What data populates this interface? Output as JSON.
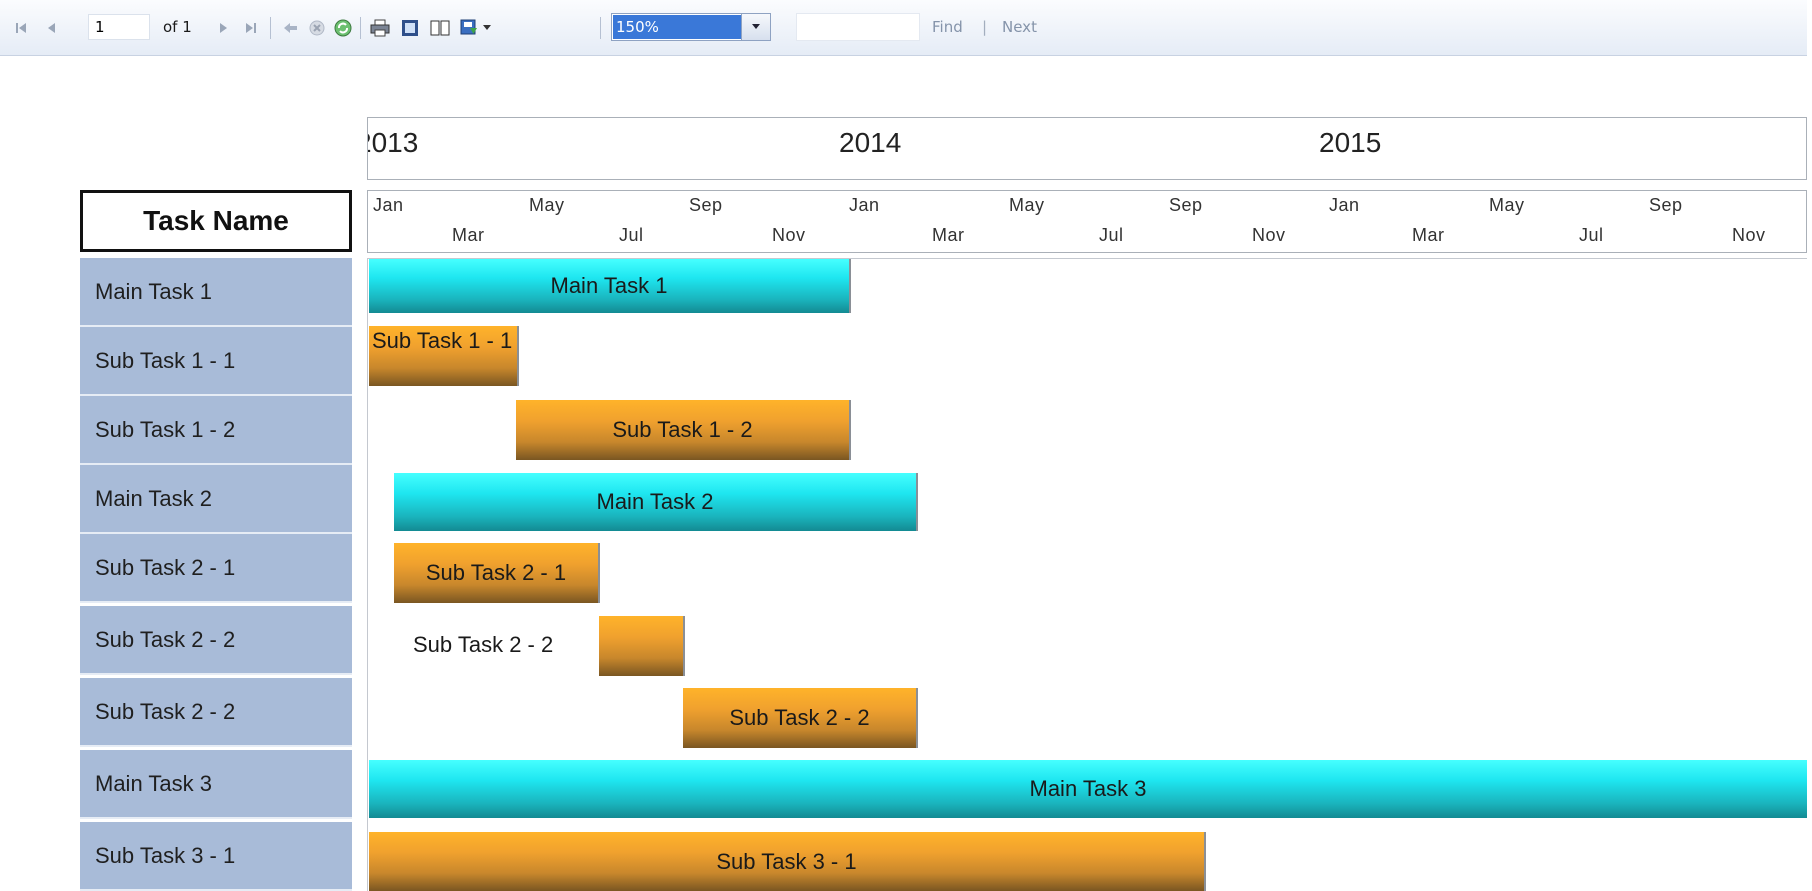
{
  "toolbar": {
    "page_value": "1",
    "of_label": "of 1",
    "zoom_value": "150%",
    "find_label": "Find",
    "separator": "|",
    "next_label": "Next",
    "icons": [
      "first-page-icon",
      "previous-page-icon",
      "next-page-icon",
      "last-page-icon",
      "back-icon",
      "stop-icon",
      "refresh-icon",
      "print-icon",
      "print-layout-icon",
      "page-setup-icon",
      "export-icon",
      "dropdown-arrow-icon"
    ]
  },
  "timeline": {
    "years": [
      "2013",
      "2014",
      "2015"
    ],
    "months_top": [
      "Jan",
      "May",
      "Sep",
      "Jan",
      "May",
      "Sep",
      "Jan",
      "May",
      "Sep"
    ],
    "months_bottom": [
      "Mar",
      "Jul",
      "Nov",
      "Mar",
      "Jul",
      "Nov",
      "Mar",
      "Jul",
      "Nov"
    ]
  },
  "header": {
    "task_name": "Task Name"
  },
  "tasks": [
    {
      "name": "Main Task 1",
      "bar_label": "Main Task 1",
      "kind": "main",
      "start": "2013-01",
      "end": "2013-12"
    },
    {
      "name": "Sub Task 1 - 1",
      "bar_label": "Sub Task 1 - 1",
      "kind": "sub",
      "start": "2013-01",
      "end": "2013-04"
    },
    {
      "name": "Sub Task 1 - 2",
      "bar_label": "Sub Task 1 - 2",
      "kind": "sub",
      "start": "2013-04",
      "end": "2013-12"
    },
    {
      "name": "Main Task 2",
      "bar_label": "Main Task 2",
      "kind": "main",
      "start": "2013-02",
      "end": "2014-02"
    },
    {
      "name": "Sub Task 2 - 1",
      "bar_label": "Sub Task 2 - 1",
      "kind": "sub",
      "start": "2013-02",
      "end": "2013-06"
    },
    {
      "name": "Sub Task 2 - 2",
      "bar_label": "Sub Task 2 - 2",
      "kind": "sub",
      "start": "2013-06",
      "end": "2013-08"
    },
    {
      "name": "Sub Task 2 - 2",
      "bar_label": "Sub Task 2 - 2",
      "kind": "sub",
      "start": "2013-08",
      "end": "2014-02"
    },
    {
      "name": "Main Task 3",
      "bar_label": "Main Task 3",
      "kind": "main",
      "start": "2013-01",
      "end": "2015-12"
    },
    {
      "name": "Sub Task 3 - 1",
      "bar_label": "Sub Task 3 - 1",
      "kind": "sub",
      "start": "2013-01",
      "end": "2014-08"
    }
  ],
  "colors": {
    "main_bar": "#1ee6f0",
    "sub_bar": "#f0a12e",
    "task_cell": "#a8bbd8"
  }
}
